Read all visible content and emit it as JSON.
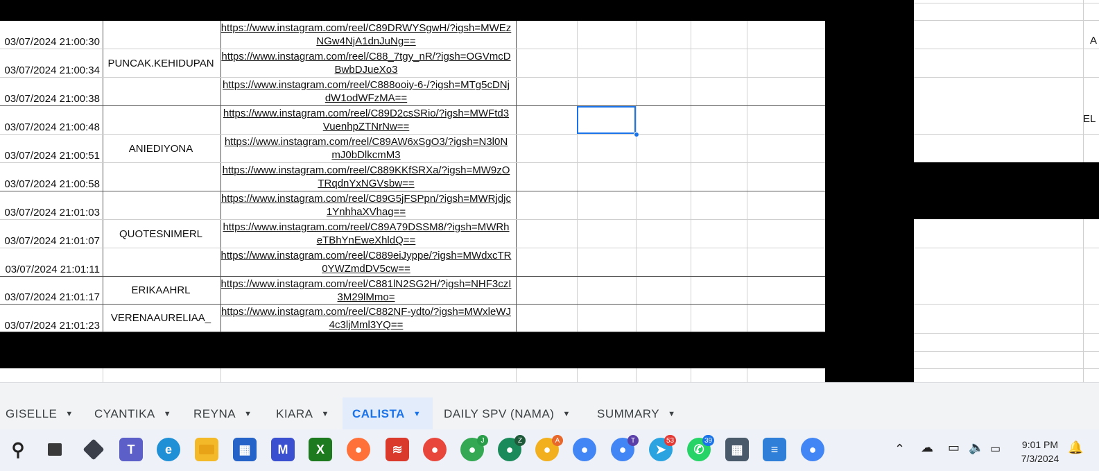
{
  "rows": [
    {
      "timestamp": "03/07/2024 21:00:30",
      "link": "https://www.instagram.com/reel/C89DRWYSgwH/?igsh=MWEzNGw4NjA1dnJuNg=="
    },
    {
      "timestamp": "03/07/2024 21:00:34",
      "link": "https://www.instagram.com/reel/C88_7tgy_nR/?igsh=OGVmcDBwbDJueXo3"
    },
    {
      "timestamp": "03/07/2024 21:00:38",
      "link": "https://www.instagram.com/reel/C888ooiy-6-/?igsh=MTg5cDNjdW1odWFzMA=="
    },
    {
      "timestamp": "03/07/2024 21:00:48",
      "link": "https://www.instagram.com/reel/C89D2csSRio/?igsh=MWFtd3VuenhpZTNrNw=="
    },
    {
      "timestamp": "03/07/2024 21:00:51",
      "link": "https://www.instagram.com/reel/C89AW6xSgO3/?igsh=N3l0NmJ0bDlkcmM3"
    },
    {
      "timestamp": "03/07/2024 21:00:58",
      "link": "https://www.instagram.com/reel/C889KKfSRXa/?igsh=MW9zOTRqdnYxNGVsbw=="
    },
    {
      "timestamp": "03/07/2024 21:01:03",
      "link": "https://www.instagram.com/reel/C89G5jFSPpn/?igsh=MWRjdjc1YnhhaXVhag=="
    },
    {
      "timestamp": "03/07/2024 21:01:07",
      "link": "https://www.instagram.com/reel/C89A79DSSM8/?igsh=MWRheTBhYnEweXhldQ=="
    },
    {
      "timestamp": "03/07/2024 21:01:11",
      "link": "https://www.instagram.com/reel/C889eiJyppe/?igsh=MWdxcTR0YWZmdDV5cw=="
    },
    {
      "timestamp": "03/07/2024 21:01:17",
      "link": "https://www.instagram.com/reel/C881lN2SG2H/?igsh=NHF3czI3M29lMmo="
    },
    {
      "timestamp": "03/07/2024 21:01:23",
      "link": "https://www.instagram.com/reel/C882NF-ydto/?igsh=MWxleWJ4c3ljMml3YQ=="
    }
  ],
  "usernames": [
    "PUNCAK.KEHIDUPAN",
    "ANIEDIYONA",
    "QUOTESNIMERL",
    "ERIKAAHRL",
    "VERENAAURELIAA_"
  ],
  "right_fragments": {
    "frag1": "A",
    "frag2": "EL"
  },
  "sheet_tabs": [
    {
      "label": "GISELLE",
      "active": false
    },
    {
      "label": "CYANTIKA",
      "active": false
    },
    {
      "label": "REYNA",
      "active": false
    },
    {
      "label": "KIARA",
      "active": false
    },
    {
      "label": "CALISTA",
      "active": true
    },
    {
      "label": "DAILY SPV (NAMA)",
      "active": false
    },
    {
      "label": "SUMMARY",
      "active": false
    }
  ],
  "taskbar": {
    "badges": {
      "firefox_profile_a": "53",
      "whatsapp": "39"
    },
    "profile_letters": {
      "p1": "J",
      "p2": "Z",
      "p3": "A",
      "p4": "T"
    },
    "clock_time": "9:01 PM",
    "clock_date": "7/3/2024"
  },
  "colors": {
    "accent": "#1a73e8",
    "redaction": "#000000",
    "gridline": "#cfcfcf"
  }
}
